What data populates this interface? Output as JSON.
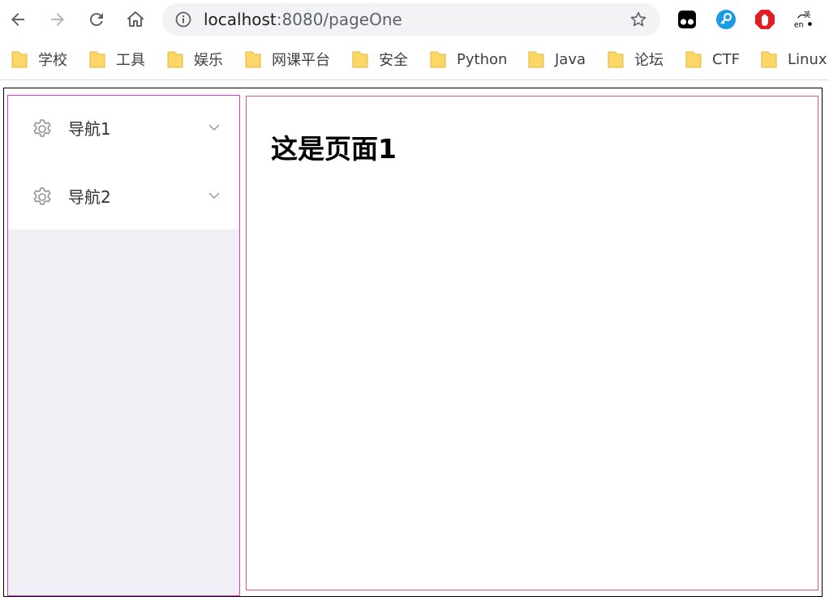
{
  "browser": {
    "url_host": "localhost",
    "url_path": ":8080/pageOne",
    "bookmarks": [
      "学校",
      "工具",
      "娱乐",
      "网课平台",
      "安全",
      "Python",
      "Java",
      "论坛",
      "CTF",
      "Linux"
    ],
    "extension_icons": [
      "tampermonkey-icon",
      "password-key-icon",
      "adblock-icon",
      "translate-icon"
    ]
  },
  "sidebar": {
    "items": [
      {
        "label": "导航1",
        "icon": "gear-icon"
      },
      {
        "label": "导航2",
        "icon": "gear-icon"
      }
    ]
  },
  "main": {
    "heading": "这是页面1"
  },
  "colors": {
    "sidebar_border": "#d63ad6",
    "main_border": "#e05a6a",
    "sidebar_bg": "#eef0f6"
  }
}
